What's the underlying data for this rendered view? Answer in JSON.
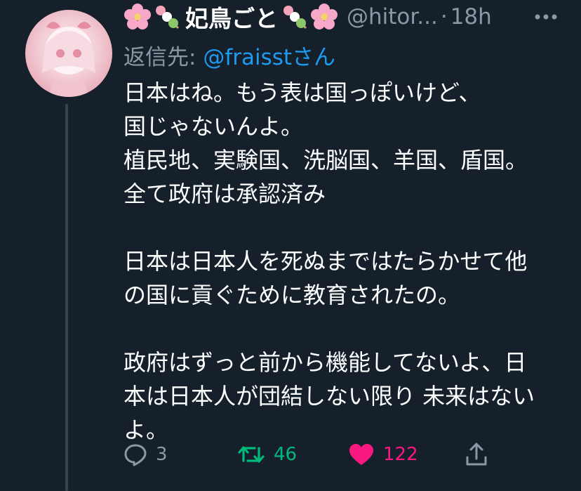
{
  "tweet": {
    "display_name": "妃鳥ごと",
    "handle": "@hitor...",
    "separator": "·",
    "time": "18h",
    "more_icon": "more-horizontal-icon",
    "reply_label": "返信先:",
    "reply_to": "@fraisst",
    "reply_suffix": "さん",
    "lines": [
      "日本はね。もう表は国っぽいけど、",
      "国じゃないんよ。",
      "植民地、実験国、洗脳国、羊国、盾国。",
      "全て政府は承認済み",
      "",
      "日本は日本人を死ぬまではたらかせて他",
      "の国に貢ぐために教育されたの。",
      "",
      "政府はずっと前から機能してないよ、日",
      "本は日本人が団結しない限り 未来はない",
      "よ。"
    ]
  },
  "actions": {
    "reply_count": "3",
    "retweet_count": "46",
    "like_count": "122",
    "colors": {
      "muted": "#8b98a5",
      "retweet": "#00ba7c",
      "like": "#f91880",
      "link": "#1d9bf0"
    }
  }
}
